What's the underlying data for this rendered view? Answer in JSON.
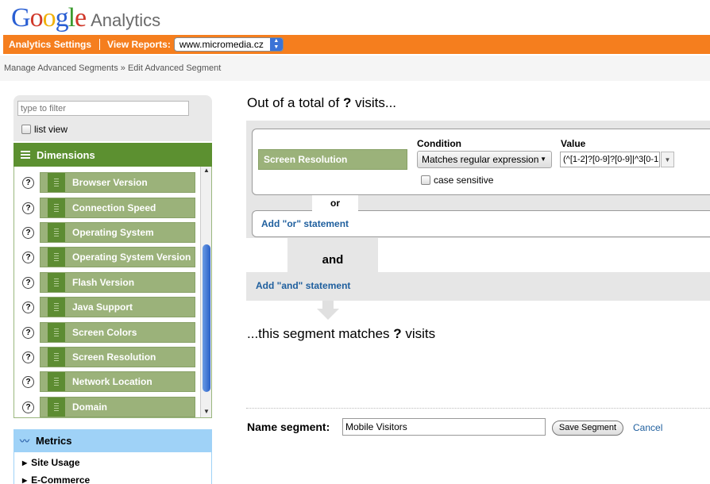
{
  "logo": {
    "letters": [
      {
        "ch": "G",
        "color": "#2a5fd3"
      },
      {
        "ch": "o",
        "color": "#d0382a"
      },
      {
        "ch": "o",
        "color": "#f0b10b"
      },
      {
        "ch": "g",
        "color": "#2a5fd3"
      },
      {
        "ch": "l",
        "color": "#3a9a2e"
      },
      {
        "ch": "e",
        "color": "#d0382a"
      }
    ],
    "product": "Analytics"
  },
  "topbar": {
    "settings_label": "Analytics Settings",
    "view_reports_label": "View Reports:",
    "site_select": "www.micromedia.cz",
    "accent_color": "#f57e1e"
  },
  "breadcrumb": "Manage Advanced Segments » Edit Advanced Segment",
  "filter": {
    "placeholder": "type to filter",
    "list_view_label": "list view"
  },
  "dimensions": {
    "title": "Dimensions",
    "items": [
      "Browser Version",
      "Connection Speed",
      "Operating System",
      "Operating System Version",
      "Flash Version",
      "Java Support",
      "Screen Colors",
      "Screen Resolution",
      "Network Location",
      "Domain"
    ],
    "help_glyph": "?"
  },
  "metrics": {
    "title": "Metrics",
    "items": [
      "Site Usage",
      "E-Commerce"
    ]
  },
  "segment": {
    "total_prefix": "Out of a total of ",
    "total_value": "?",
    "total_suffix": " visits...",
    "dimension": "Screen Resolution",
    "condition_label": "Condition",
    "condition_value": "Matches regular expression",
    "value_label": "Value",
    "value_text": "(^[1-2]?[0-9]?[0-9]|^3[0-1",
    "case_sensitive_label": "case sensitive",
    "or_label": "or",
    "add_or": "Add \"or\" statement",
    "and_label": "and",
    "add_and": "Add \"and\" statement",
    "matches_prefix": "...this segment matches ",
    "matches_value": "?",
    "matches_suffix": " visits"
  },
  "name_segment": {
    "label": "Name segment:",
    "value": "Mobile Visitors",
    "save_label": "Save Segment",
    "cancel_label": "Cancel"
  }
}
